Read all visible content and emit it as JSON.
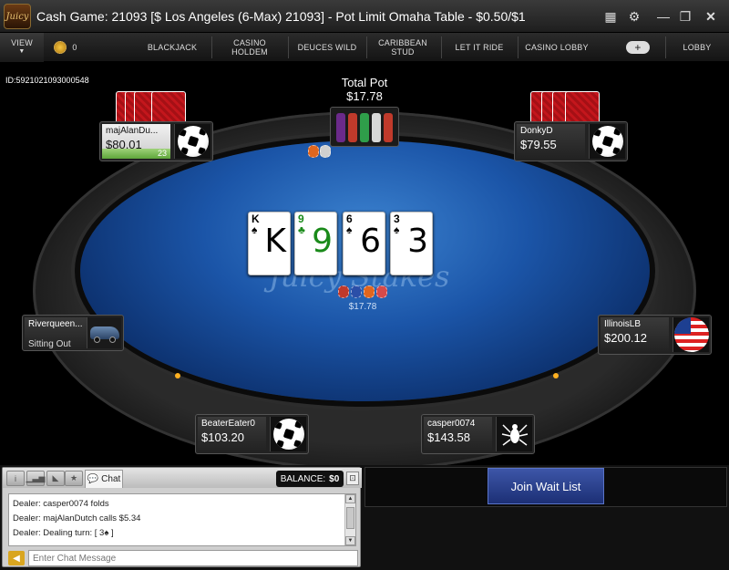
{
  "window": {
    "title": "Cash Game: 21093 [$ Los Angeles (6-Max) 21093] - Pot Limit Omaha Table - $0.50/$1",
    "logo_text": "Juicy Stakes"
  },
  "nav": {
    "view_label": "VIEW",
    "chips": "0",
    "items": [
      "BLACKJACK",
      "CASINO\nHOLDEM",
      "DEUCES WILD",
      "CARIBBEAN\nSTUD",
      "LET IT RIDE",
      "CASINO LOBBY"
    ],
    "lobby": "LOBBY"
  },
  "table": {
    "id": "ID:5921021093000548",
    "total_pot_label": "Total Pot",
    "total_pot": "$17.78",
    "pot_amount": "$17.78",
    "logo": "Juicy Stakes",
    "board": [
      {
        "rank": "K",
        "suit": "♠",
        "color": "black"
      },
      {
        "rank": "9",
        "suit": "♣",
        "color": "green"
      },
      {
        "rank": "6",
        "suit": "♠",
        "color": "black"
      },
      {
        "rank": "3",
        "suit": "♠",
        "color": "black"
      }
    ]
  },
  "seats": {
    "top_left": {
      "name": "majAlanDu...",
      "stack": "$80.01",
      "timer": "23",
      "avatar": "soccer-ball-icon"
    },
    "top_right": {
      "name": "DonkyD",
      "stack": "$79.55",
      "avatar": "soccer-ball-icon"
    },
    "left": {
      "name": "Riverqueen...",
      "status": "Sitting Out",
      "avatar": "car-icon"
    },
    "right": {
      "name": "IllinoisLB",
      "stack": "$200.12",
      "avatar": "us-flag-icon"
    },
    "bottom_left": {
      "name": "BeaterEater0",
      "stack": "$103.20",
      "avatar": "soccer-ball-icon"
    },
    "bottom_right": {
      "name": "casper0074",
      "stack": "$143.58",
      "avatar": "spider-icon"
    }
  },
  "chat": {
    "tab_label": "Chat",
    "balance_label": "BALANCE:",
    "balance_value": "$0",
    "lines": [
      "Dealer: casper0074 folds",
      "Dealer: majAlanDutch calls $5.34",
      "Dealer: Dealing turn: [ 3♠ ]"
    ],
    "placeholder": "Enter Chat Message"
  },
  "join_wait_list": "Join Wait List"
}
